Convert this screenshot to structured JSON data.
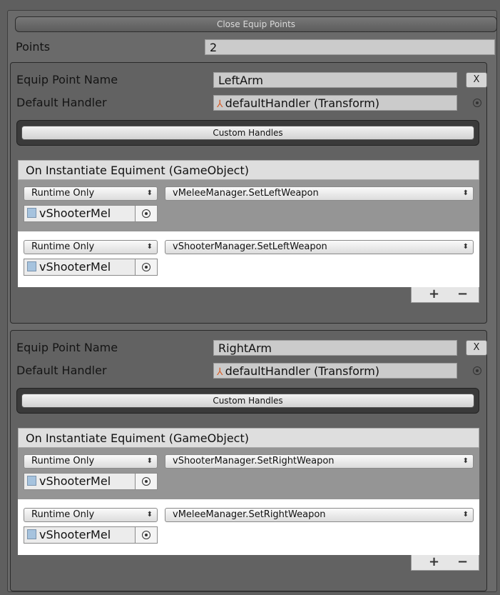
{
  "header": {
    "close_button": "Close Equip Points"
  },
  "points": {
    "label": "Points",
    "value": "2"
  },
  "equip_points": [
    {
      "name_label": "Equip Point Name",
      "name_value": "LeftArm",
      "remove_label": "X",
      "handler_label": "Default Handler",
      "handler_value": "defaultHandler (Transform)",
      "custom_handles_label": "Custom Handles",
      "event_title": "On Instantiate Equiment (GameObject)",
      "listeners": [
        {
          "mode": "Runtime Only",
          "function": "vMeleeManager.SetLeftWeapon",
          "object": "vShooterMel"
        },
        {
          "mode": "Runtime Only",
          "function": "vShooterManager.SetLeftWeapon",
          "object": "vShooterMel"
        }
      ],
      "add_label": "+",
      "remove_listener_label": "−"
    },
    {
      "name_label": "Equip Point Name",
      "name_value": "RightArm",
      "remove_label": "X",
      "handler_label": "Default Handler",
      "handler_value": "defaultHandler (Transform)",
      "custom_handles_label": "Custom Handles",
      "event_title": "On Instantiate Equiment (GameObject)",
      "listeners": [
        {
          "mode": "Runtime Only",
          "function": "vShooterManager.SetRightWeapon",
          "object": "vShooterMel"
        },
        {
          "mode": "Runtime Only",
          "function": "vMeleeManager.SetRightWeapon",
          "object": "vShooterMel"
        }
      ],
      "add_label": "+",
      "remove_listener_label": "−"
    }
  ],
  "icons": {
    "transform": "transform-icon",
    "script": "script-file-icon",
    "picker": "object-picker-icon",
    "dropdown": "dropdown-arrows-icon"
  }
}
